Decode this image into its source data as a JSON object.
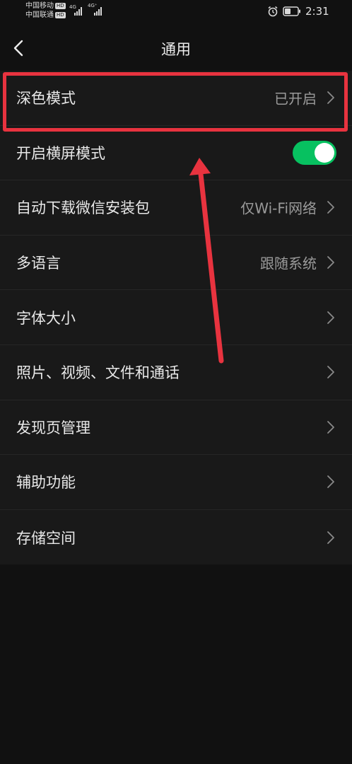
{
  "status_bar": {
    "carrier_1": "中国移动",
    "carrier_2": "中国联通",
    "hd_badge": "HD",
    "network_1": "4G",
    "network_2": "4G⁺",
    "time": "2:31",
    "icons": [
      "signal-icon",
      "alarm-icon",
      "battery-icon"
    ]
  },
  "nav": {
    "back_icon": "chevron-left-icon",
    "title": "通用"
  },
  "settings": [
    {
      "label": "深色模式",
      "value": "已开启",
      "has_chevron": true
    },
    {
      "label": "开启横屏模式",
      "toggle": true
    },
    {
      "label": "自动下载微信安装包",
      "value": "仅Wi-Fi网络",
      "has_chevron": true
    },
    {
      "label": "多语言",
      "value": "跟随系统",
      "has_chevron": true
    },
    {
      "label": "字体大小",
      "value": "",
      "has_chevron": true
    },
    {
      "label": "照片、视频、文件和通话",
      "value": "",
      "has_chevron": true
    },
    {
      "label": "发现页管理",
      "value": "",
      "has_chevron": true
    },
    {
      "label": "辅助功能",
      "value": "",
      "has_chevron": true
    },
    {
      "label": "存储空间",
      "value": "",
      "has_chevron": true
    }
  ],
  "colors": {
    "background": "#111111",
    "list_background": "#191919",
    "toggle_on": "#07c160",
    "annotation": "#e8333f"
  }
}
